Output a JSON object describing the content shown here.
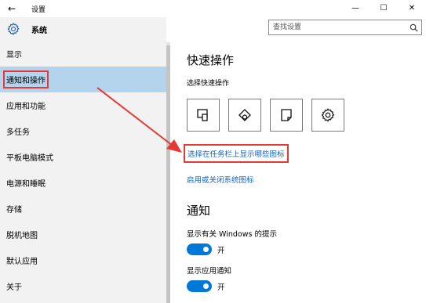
{
  "window": {
    "title": "设置",
    "back_glyph": "←",
    "minimize_glyph": "—",
    "maximize_glyph": "☐",
    "close_glyph": "✕"
  },
  "sidebar": {
    "header_label": "系统",
    "items": [
      {
        "label": "显示"
      },
      {
        "label": "通知和操作"
      },
      {
        "label": "应用和功能"
      },
      {
        "label": "多任务"
      },
      {
        "label": "平板电脑模式"
      },
      {
        "label": "电源和睡眠"
      },
      {
        "label": "存储"
      },
      {
        "label": "脱机地图"
      },
      {
        "label": "默认应用"
      },
      {
        "label": "关于"
      }
    ],
    "active_index": 1
  },
  "search": {
    "placeholder": "查找设置"
  },
  "main": {
    "quick_actions_title": "快速操作",
    "quick_actions_subtitle": "选择快速操作",
    "tiles": [
      {
        "icon": "tablet-mode-icon"
      },
      {
        "icon": "location-icon"
      },
      {
        "icon": "note-icon"
      },
      {
        "icon": "settings-icon"
      }
    ],
    "link_taskbar_icons": "选择在任务栏上显示哪些图标",
    "link_system_icons": "启用或关闭系统图标",
    "notifications_title": "通知",
    "setting1_label": "显示有关 Windows 的提示",
    "setting1_state": "开",
    "setting2_label": "显示应用通知",
    "setting2_state": "开"
  },
  "colors": {
    "accent": "#0078d7",
    "link": "#1565c0",
    "highlight_box": "#e53935",
    "active_item": "#b3d4ec",
    "sidebar_bg": "#f2f2f2"
  }
}
